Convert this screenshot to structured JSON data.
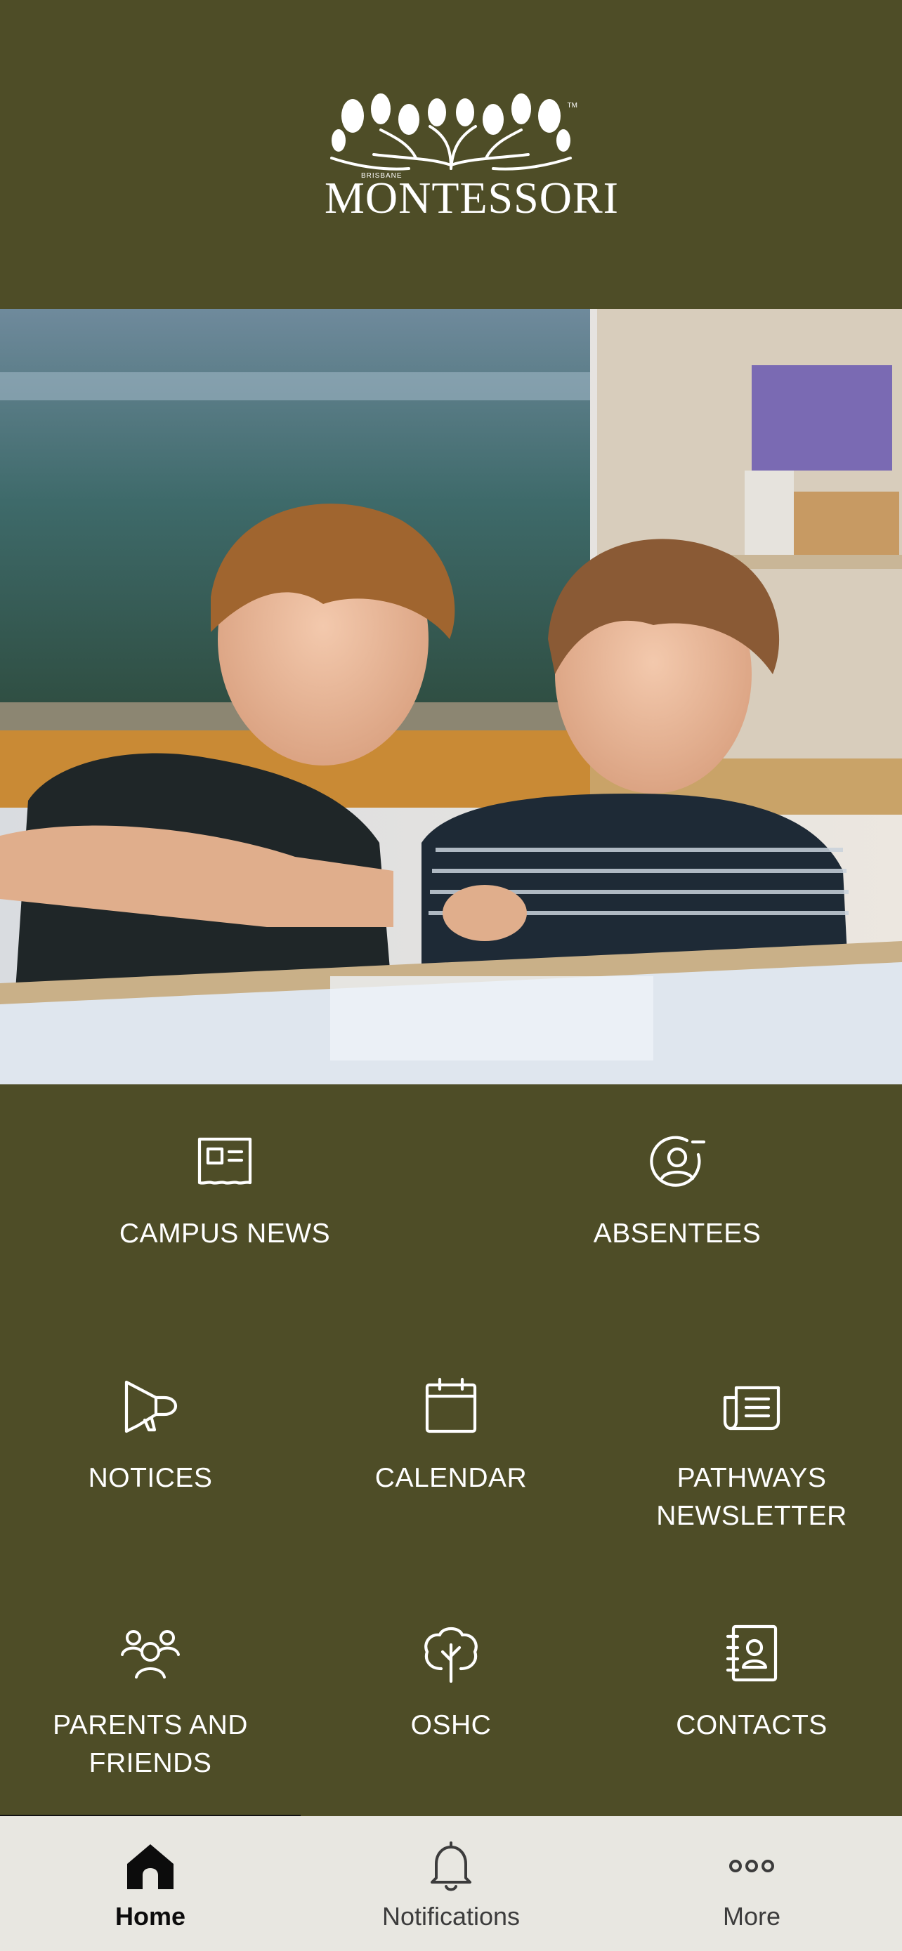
{
  "header": {
    "logo_word": "MONTESSORI",
    "logo_sub": "BRISBANE",
    "logo_tm": "TM",
    "background": "#4e4d27"
  },
  "hero": {
    "image": "photo-two-boys-working-at-classroom-table"
  },
  "tiles": [
    {
      "label": "CAMPUS NEWS",
      "icon": "newspaper-icon"
    },
    {
      "label": "ABSENTEES",
      "icon": "user-minus-icon"
    },
    {
      "label": "NOTICES",
      "icon": "megaphone-icon"
    },
    {
      "label": "CALENDAR",
      "icon": "calendar-icon"
    },
    {
      "label": "PATHWAYS\nNEWSLETTER",
      "icon": "newsletter-icon"
    },
    {
      "label": "PARENTS AND\nFRIENDS",
      "icon": "users-icon"
    },
    {
      "label": "OSHC",
      "icon": "tree-icon"
    },
    {
      "label": "CONTACTS",
      "icon": "contact-book-icon"
    }
  ],
  "tabbar": {
    "tabs": [
      {
        "label": "Home",
        "icon": "home-icon",
        "active": true
      },
      {
        "label": "Notifications",
        "icon": "bell-icon",
        "active": false
      },
      {
        "label": "More",
        "icon": "more-dots-icon",
        "active": false
      }
    ]
  }
}
